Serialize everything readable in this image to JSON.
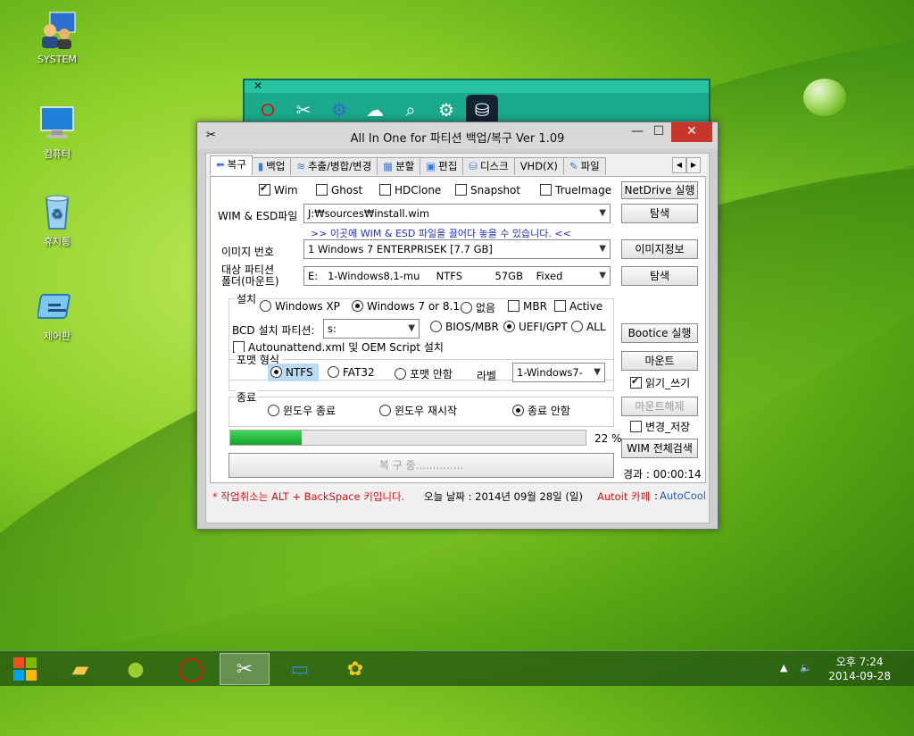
{
  "desktop": {
    "icons": [
      {
        "label": "SYSTEM"
      },
      {
        "label": "컴퓨터"
      },
      {
        "label": "휴지통"
      },
      {
        "label": "제어판"
      }
    ]
  },
  "dock": {
    "close": "✕",
    "items": [
      "opera-icon",
      "tools-icon",
      "network-icon",
      "ghost-icon",
      "search-icon",
      "settings-icon",
      "disk-icon",
      "recycle-icon",
      "wrench-icon",
      "browser-icon",
      "flag-icon",
      "tools2-icon"
    ]
  },
  "window": {
    "title": "All In One for 파티션 백업/복구 Ver 1.09",
    "minimize": "—",
    "maximize": "☐",
    "close": "✕",
    "tabs": [
      "복구",
      "백업",
      "추출/병합/변경",
      "분할",
      "편집",
      "디스크",
      "VHD(X)",
      "파일"
    ],
    "tab_left": "◀",
    "tab_right": "▶",
    "checks_top": {
      "wim": "Wim",
      "ghost": "Ghost",
      "hdclone": "HDClone",
      "snapshot": "Snapshot",
      "trueimage": "TrueImage"
    },
    "netdrive_button": "NetDrive 실행",
    "wim_label": "WIM & ESD파일",
    "wim_value": "J:₩sources₩install.wim",
    "browse_button_1": "탐색",
    "drop_hint": ">> 이곳에 WIM & ESD 파일을 끌어다 놓을 수 있습니다. <<",
    "image_no_label": "이미지 번호",
    "image_no_value": "1   Windows 7 ENTERPRISEK [7.7 GB]",
    "image_info_button": "이미지정보",
    "target_label": "대상 파티션\n폴더(마운트)",
    "target_label_1": "대상 파티션",
    "target_label_2": "폴더(마운트)",
    "target_value": "E:   1-Windows8.1-mu     NTFS          57GB    Fixed",
    "browse_button_2": "탐색",
    "install_group": "설치",
    "install_opts": [
      "Windows XP",
      "Windows 7 or 8.1",
      "없음"
    ],
    "mbr": "MBR",
    "active": "Active",
    "bcd_label": "BCD 설치 파티션:",
    "bcd_value": "s:",
    "bios_mbr": "BIOS/MBR",
    "uefi_gpt": "UEFI/GPT",
    "all": "ALL",
    "autounattend": "Autounattend.xml 및 OEM Script 설치",
    "bootice_button": "Bootice 실행",
    "format_group": "포맷 형식",
    "fmt_ntfs": "NTFS",
    "fmt_fat32": "FAT32",
    "fmt_none": "포맷 안함",
    "label_label": "라벨",
    "label_value": "1-Windows7-",
    "mount_button": "마운트",
    "readwrite": "읽기_쓰기",
    "unmount_button": "마운트해제",
    "save_changes": "변경_저장",
    "exit_group": "종료",
    "exit_shutdown": "윈도우 종료",
    "exit_restart": "윈도우 재시작",
    "exit_none": "종료 안함",
    "progress_percent_text": "22 %",
    "progress_value": 0.2,
    "restore_button": "복 구 중..............",
    "wim_search_button": "WIM 전체검색",
    "elapsed_text": "경과 :  00:00:14",
    "status_cancel": "* 작업취소는 ALT + BackSpace 키입니다.",
    "status_date": "오늘 날짜 : 2014년 09월 28일 (일)",
    "status_autoit": "Autoit 카페",
    "status_sep": " : ",
    "status_autocool": "AutoCool"
  },
  "taskbar": {
    "clock_time": "오후 7:24",
    "clock_date": "2014-09-28",
    "tray_arrow": "▲",
    "tray_speaker": "🔈"
  }
}
